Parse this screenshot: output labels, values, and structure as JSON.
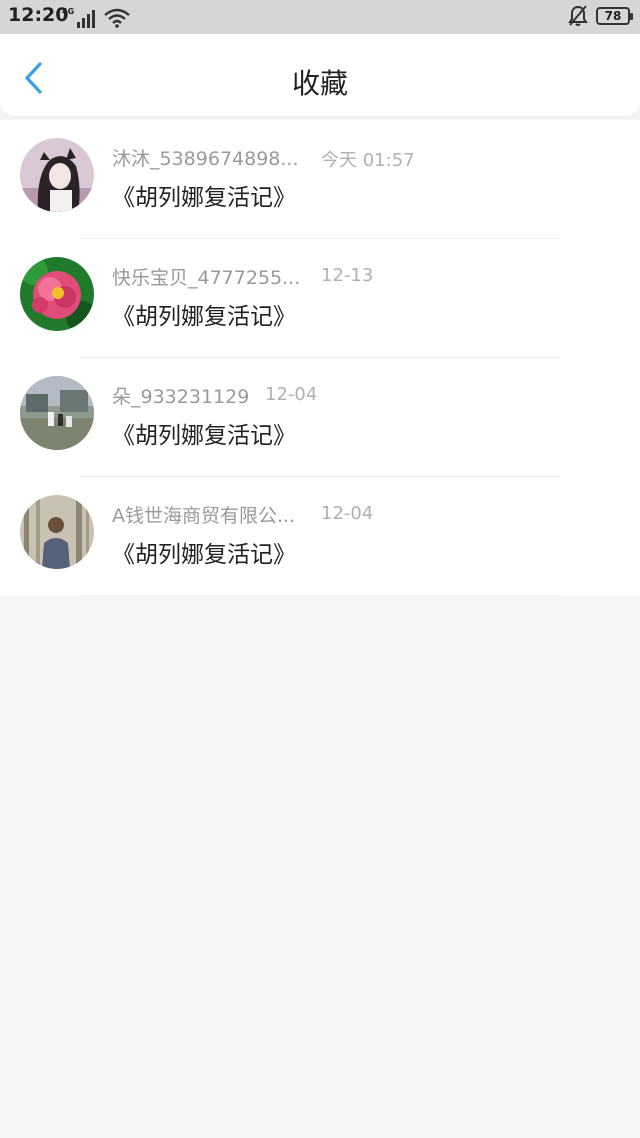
{
  "status_bar": {
    "time": "12:20",
    "network": "4G",
    "battery": "78"
  },
  "header": {
    "title": "收藏"
  },
  "favorites": [
    {
      "user": "沐沐_5389674898...",
      "time": "今天 01:57",
      "title": "《胡列娜复活记》"
    },
    {
      "user": "快乐宝贝_4777255...",
      "time": "12-13",
      "title": "《胡列娜复活记》"
    },
    {
      "user": "朵_933231129",
      "time": "12-04",
      "title": "《胡列娜复活记》"
    },
    {
      "user": "A钱世海商贸有限公...",
      "time": "12-04",
      "title": "《胡列娜复活记》"
    }
  ],
  "colors": {
    "accent": "#3a9ee8",
    "background": "#f7f5f6"
  }
}
